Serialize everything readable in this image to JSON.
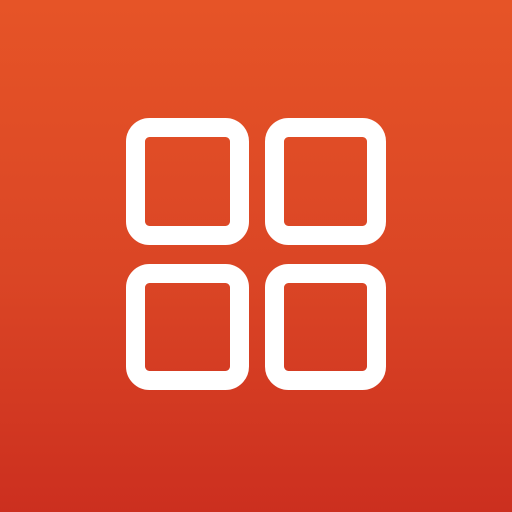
{
  "app_icon": {
    "icon": "grid-icon",
    "colors": {
      "background_top": "#E65427",
      "background_bottom": "#CC2F1F",
      "glyph": "#FFFFFF"
    },
    "tiles": [
      "top-left",
      "top-right",
      "bottom-left",
      "bottom-right"
    ]
  }
}
